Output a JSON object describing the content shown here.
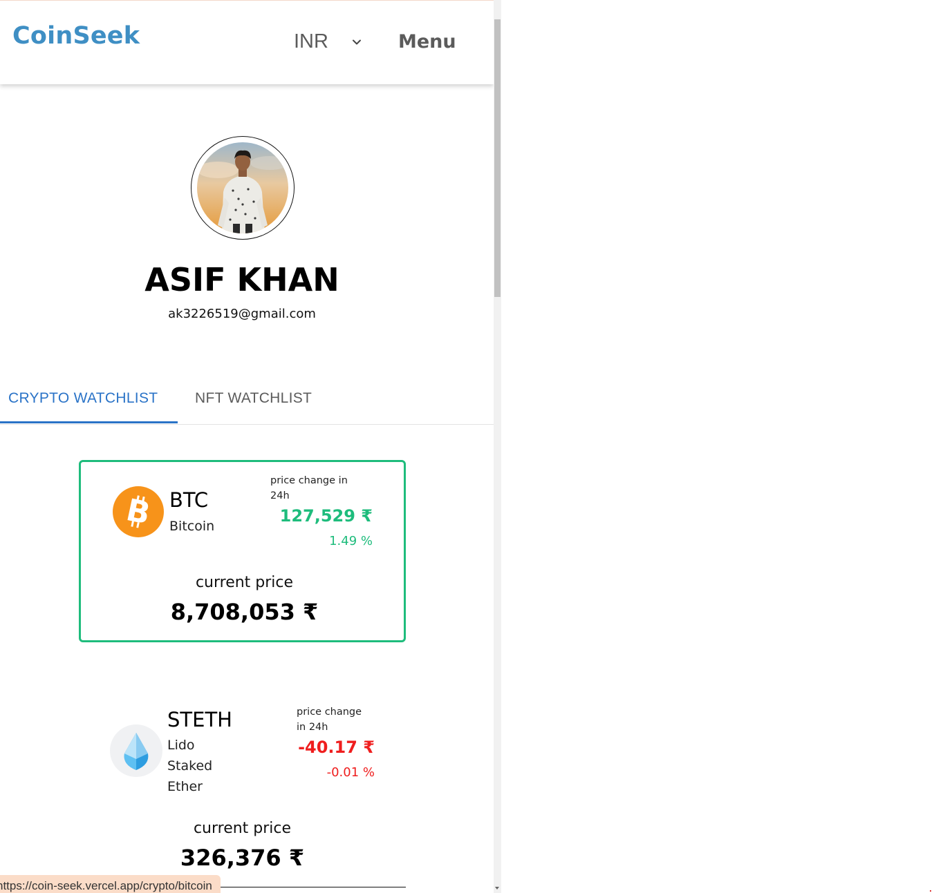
{
  "header": {
    "logo": "CoinSeek",
    "currency": "INR",
    "menu_label": "Menu"
  },
  "profile": {
    "name": "ASIF KHAN",
    "email": "ak3226519@gmail.com"
  },
  "tabs": [
    {
      "label": "CRYPTO WATCHLIST",
      "active": true
    },
    {
      "label": "NFT WATCHLIST",
      "active": false
    }
  ],
  "watchlist": [
    {
      "symbol": "BTC",
      "name": "Bitcoin",
      "price_change_label": "price change in 24h",
      "price_change_label_line1": "price change in",
      "price_change_label_line2": "24h",
      "price_change": "127,529 ₹",
      "price_change_percent": "1.49 %",
      "trend": "up",
      "current_price_label": "current price",
      "current_price": "8,708,053 ₹",
      "icon": "bitcoin-icon"
    },
    {
      "symbol": "STETH",
      "name_lines": [
        "Lido",
        "Staked",
        "Ether"
      ],
      "price_change_label_line1": "price change",
      "price_change_label_line2": "in 24h",
      "price_change": "-40.17 ₹",
      "price_change_percent": "-0.01 %",
      "trend": "down",
      "current_price_label": "current price",
      "current_price": "326,376 ₹",
      "icon": "steth-drop-icon"
    }
  ],
  "status_bar": {
    "url": "https://coin-seek.vercel.app/crypto/bitcoin"
  },
  "colors": {
    "brand": "#3f8fc4",
    "tab_active": "#2a73c7",
    "positive": "#1ebc7c",
    "negative": "#ef1e1e",
    "bitcoin_orange": "#f7931a"
  }
}
